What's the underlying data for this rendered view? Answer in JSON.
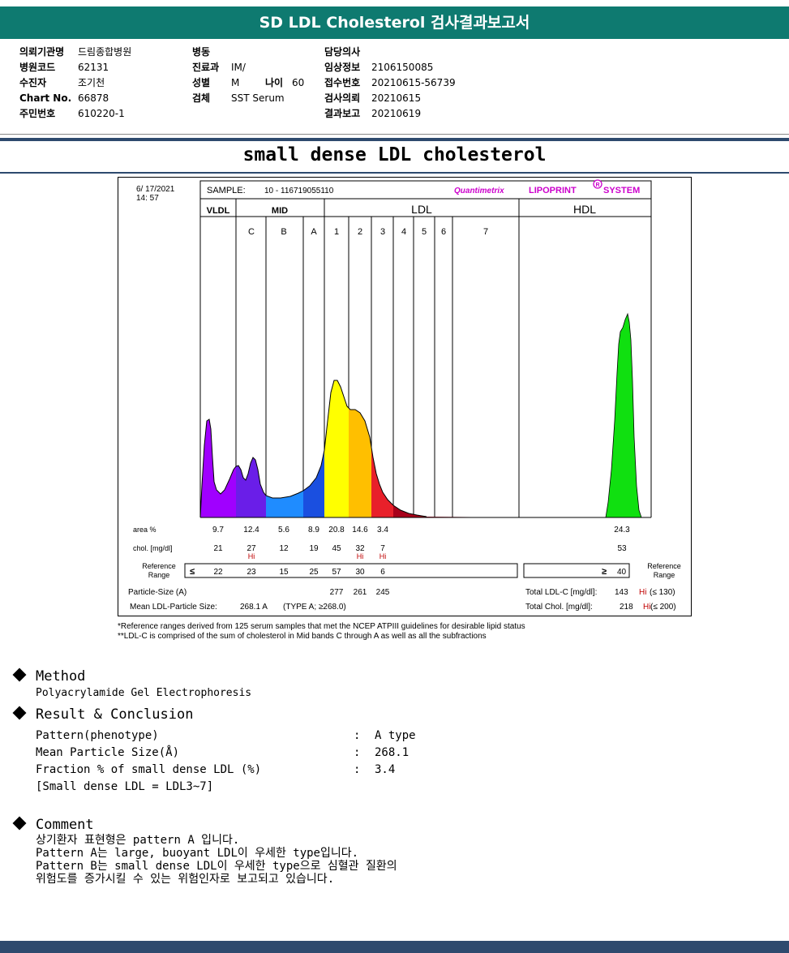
{
  "title": "SD LDL Cholesterol 검사결과보고서",
  "info": {
    "col1": [
      {
        "label": "의뢰기관명",
        "value": "드림종합병원"
      },
      {
        "label": "병원코드",
        "value": "62131"
      },
      {
        "label": "수진자",
        "value": "조기천"
      },
      {
        "label": "Chart No.",
        "value": "66878"
      },
      {
        "label": "주민번호",
        "value": "610220-1"
      }
    ],
    "col2": {
      "ward_label": "병동",
      "ward_value": "",
      "dept_label": "진료과",
      "dept_value": "IM/",
      "sex_label": "성별",
      "sex_value": "M",
      "age_label": "나이",
      "age_value": "60",
      "specimen_label": "검체",
      "specimen_value": "SST Serum"
    },
    "col3": [
      {
        "label": "담당의사",
        "value": ""
      },
      {
        "label": "임상정보",
        "value": "2106150085"
      },
      {
        "label": "접수번호",
        "value": "20210615-56739"
      },
      {
        "label": "검사의뢰",
        "value": "20210615"
      },
      {
        "label": "결과보고",
        "value": "20210619"
      }
    ]
  },
  "subtitle": "small dense LDL cholesterol",
  "chart": {
    "date": "6/ 17/2021",
    "time": "14: 57",
    "sample_label": "SAMPLE:",
    "sample_value": "10 - 116719055110",
    "brand_prefix": "Quantimetrix",
    "brand_name": "LIPOPRINT",
    "brand_mark": "R",
    "brand_suffix": "SYSTEM",
    "groups": [
      "VLDL",
      "MID",
      "LDL",
      "HDL"
    ],
    "bands": [
      "C",
      "B",
      "A",
      "1",
      "2",
      "3",
      "4",
      "5",
      "6",
      "7"
    ],
    "area_label": "area %",
    "chol_label": "chol. [mg/dl]",
    "ref_label_left": [
      "Reference",
      "Range"
    ],
    "ref_label_right": [
      "Reference",
      "Range"
    ],
    "area_values": [
      "9.7",
      "12.4",
      "5.6",
      "8.9",
      "20.8",
      "14.6",
      "3.4",
      "24.3"
    ],
    "chol_values": [
      "21",
      "27",
      "12",
      "19",
      "45",
      "32",
      "7",
      "53"
    ],
    "hi_mark": "Hi",
    "ref_le": "≤",
    "ref_ge": "≥",
    "ref_values": [
      "22",
      "23",
      "15",
      "25",
      "57",
      "30",
      "6"
    ],
    "ref_hdl": "40",
    "particle_size_label": "Particle-Size (A)",
    "particle_sizes": [
      "277",
      "261",
      "245"
    ],
    "mean_label": "Mean LDL-Particle Size:",
    "mean_value": "268.1 A",
    "mean_type": "(TYPE A; ≥268.0)",
    "total_ldl_label": "Total LDL-C [mg/dl]:",
    "total_ldl_value": "143",
    "total_ldl_ref": "(≤ 130)",
    "total_chol_label": "Total Chol. [mg/dl]:",
    "total_chol_value": "218",
    "total_chol_ref": "(≤ 200)"
  },
  "footnotes": [
    "*Reference ranges derived from 125 serum samples that met the NCEP ATPIII guidelines for desirable lipid status",
    "**LDL-C is comprised of the sum of cholesterol in Mid bands C through A as well as all the subfractions"
  ],
  "method": {
    "heading": "Method",
    "text": "Polyacrylamide Gel Electrophoresis"
  },
  "result": {
    "heading": "Result & Conclusion",
    "rows": [
      {
        "label": "Pattern(phenotype)",
        "colon": ":",
        "value": "A type"
      },
      {
        "label": "Mean Particle Size(Å)",
        "colon": ":",
        "value": "268.1"
      },
      {
        "label": "Fraction % of small dense LDL (%)",
        "colon": ":",
        "value": "3.4"
      }
    ],
    "note": "[Small dense LDL = LDL3~7]"
  },
  "comment": {
    "heading": "Comment",
    "lines": [
      "상기환자 표현형은 pattern A 입니다.",
      "Pattern A는 large, buoyant LDL이 우세한 type입니다.",
      "Pattern B는 small dense LDL이 우세한 type으로 심혈관 질환의",
      "위험도를 증가시킬 수 있는 위험인자로 보고되고 있습니다."
    ]
  }
}
